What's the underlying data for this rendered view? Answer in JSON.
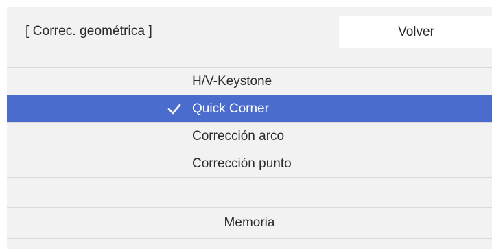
{
  "header": {
    "title": "[ Correc. geométrica ]",
    "back_label": "Volver"
  },
  "menu": {
    "items": [
      {
        "label": "H/V-Keystone",
        "selected": false
      },
      {
        "label": "Quick Corner",
        "selected": true
      },
      {
        "label": "Corrección arco",
        "selected": false
      },
      {
        "label": "Corrección punto",
        "selected": false
      }
    ],
    "memory_label": "Memoria"
  },
  "colors": {
    "background": "#f2f2f2",
    "selected": "#4a6ccc",
    "button": "#ffffff",
    "text": "#2b2b2b"
  },
  "icons": {
    "selected_marker": "check-icon"
  }
}
